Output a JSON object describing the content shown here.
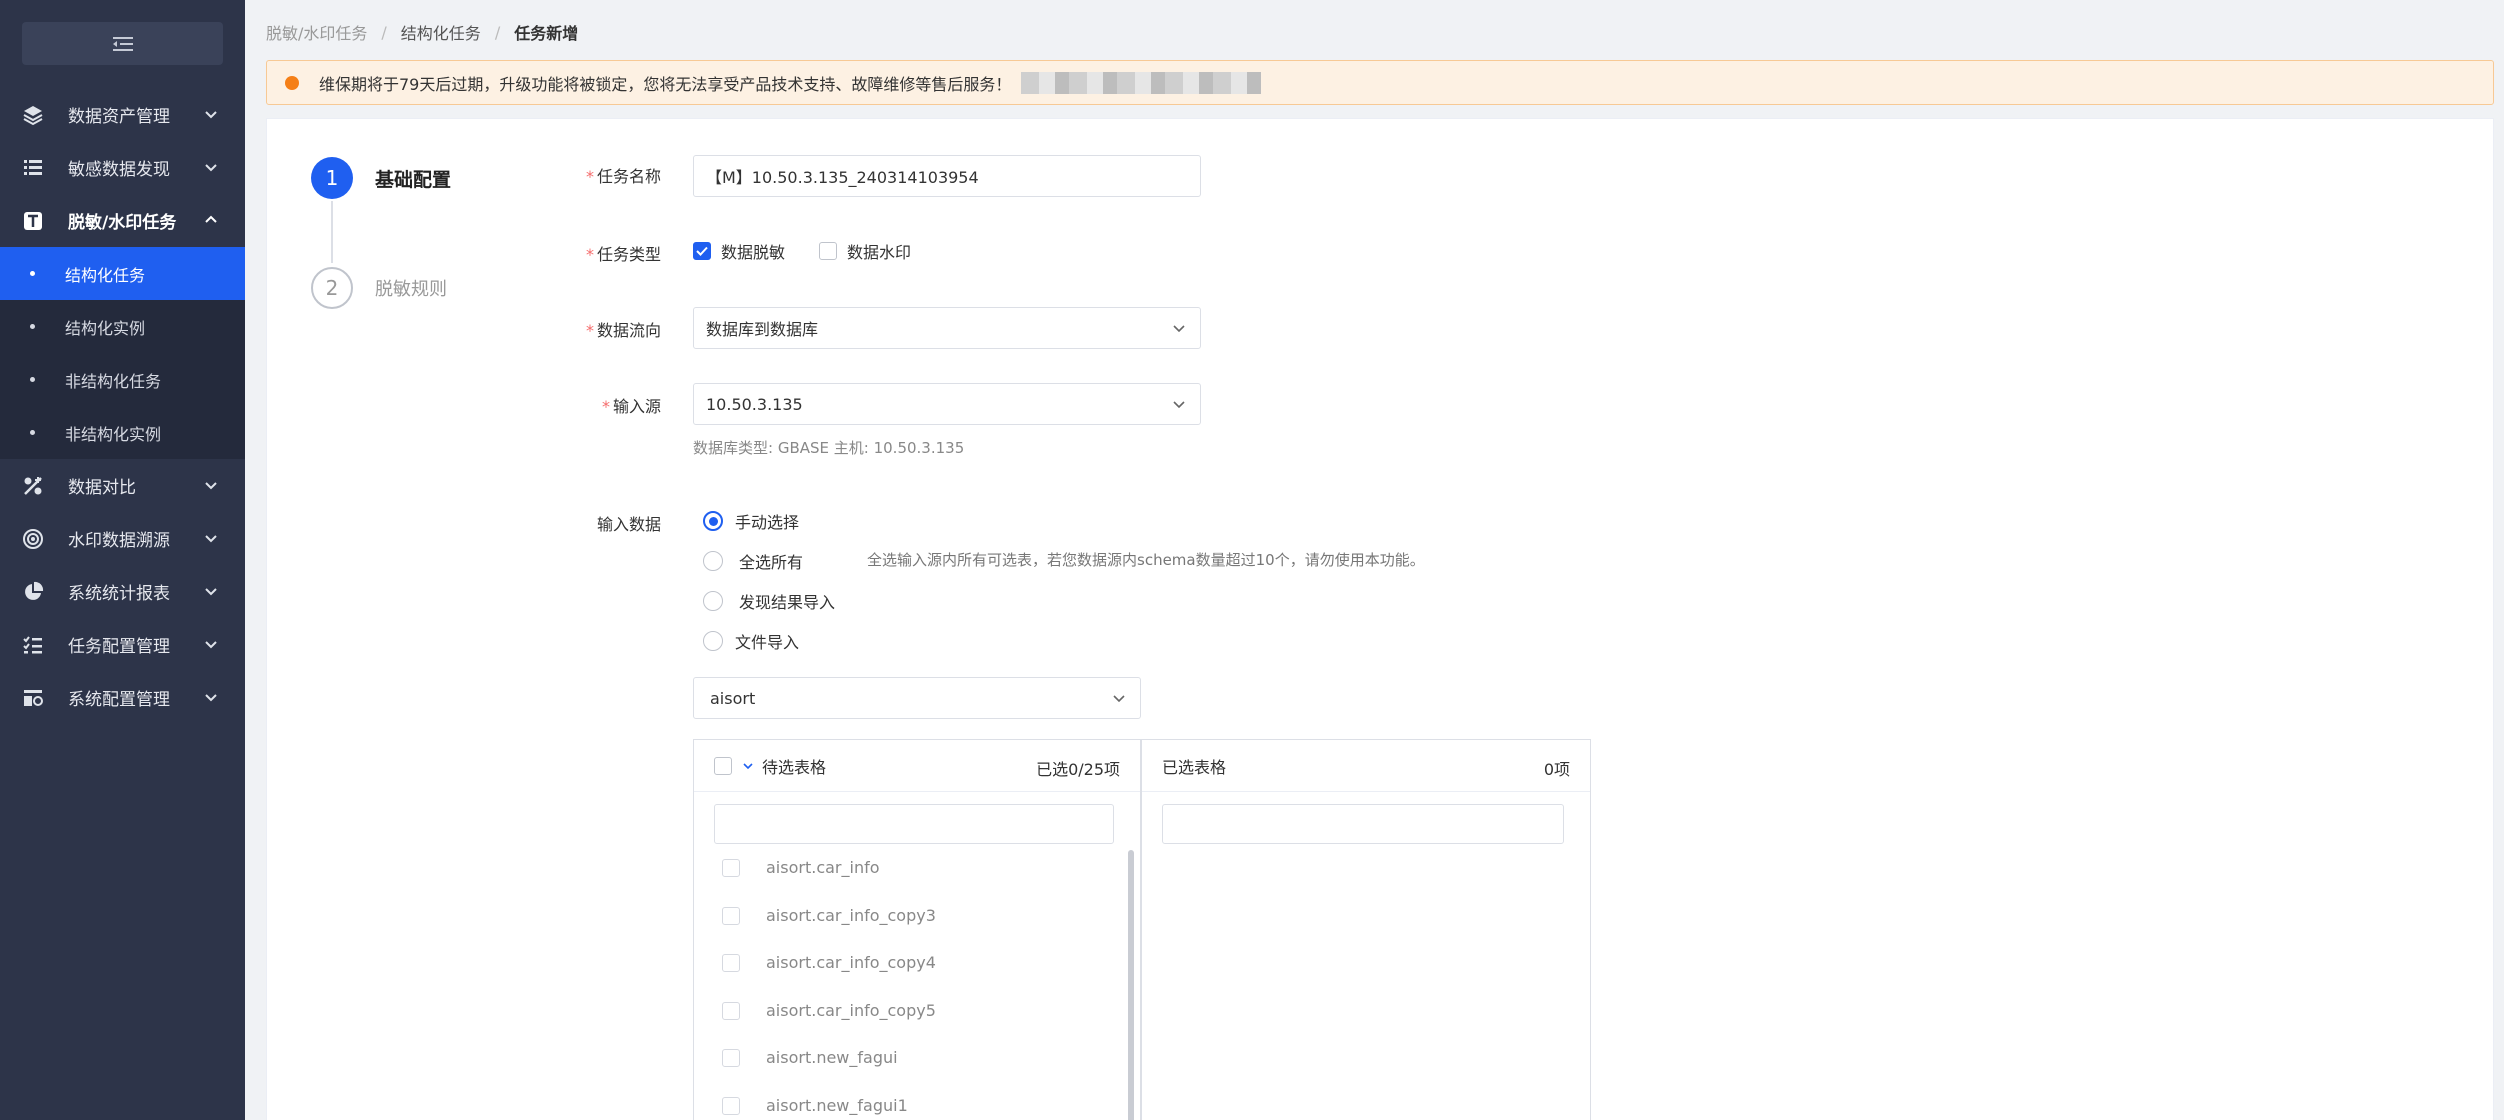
{
  "sidebar": {
    "toggle_icon": "menu-fold-icon",
    "menus": [
      {
        "label": "数据资产管理",
        "icon": "layers-icon"
      },
      {
        "label": "敏感数据发现",
        "icon": "list-icon"
      },
      {
        "label": "脱敏/水印任务",
        "icon": "text-t-icon",
        "open": true,
        "children": [
          "结构化任务",
          "结构化实例",
          "非结构化任务",
          "非结构化实例"
        ]
      },
      {
        "label": "数据对比",
        "icon": "compare-icon"
      },
      {
        "label": "水印数据溯源",
        "icon": "target-icon"
      },
      {
        "label": "系统统计报表",
        "icon": "pie-chart-icon"
      },
      {
        "label": "任务配置管理",
        "icon": "checklist-icon"
      },
      {
        "label": "系统配置管理",
        "icon": "settings-panel-icon"
      }
    ]
  },
  "breadcrumb": [
    "脱敏/水印任务",
    "结构化任务",
    "任务新增"
  ],
  "alert": {
    "text": "维保期将于79天后过期，升级功能将被锁定，您将无法享受产品技术支持、故障维修等售后服务！"
  },
  "steps": [
    {
      "num": "1",
      "label": "基础配置"
    },
    {
      "num": "2",
      "label": "脱敏规则"
    }
  ],
  "form": {
    "task_name": {
      "label": "任务名称",
      "value": "【M】10.50.3.135_240314103954"
    },
    "task_type": {
      "label": "任务类型",
      "options": [
        "数据脱敏",
        "数据水印"
      ]
    },
    "data_flow": {
      "label": "数据流向",
      "value": "数据库到数据库"
    },
    "input_source": {
      "label": "输入源",
      "value": "10.50.3.135",
      "hint": "数据库类型: GBASE    主机: 10.50.3.135"
    },
    "input_data": {
      "label": "输入数据",
      "options": [
        "手动选择",
        "全选所有",
        "发现结果导入",
        "文件导入"
      ],
      "select_all_hint": "全选输入源内所有可选表，若您数据源内schema数量超过10个，请勿使用本功能。"
    },
    "schema": {
      "value": "aisort"
    }
  },
  "transfer": {
    "left_title": "待选表格",
    "left_count": "已选0/25项",
    "right_title": "已选表格",
    "right_count": "0项",
    "items": [
      "aisort.car_info",
      "aisort.car_info_copy3",
      "aisort.car_info_copy4",
      "aisort.car_info_copy5",
      "aisort.new_fagui",
      "aisort.new_fagui1"
    ]
  }
}
